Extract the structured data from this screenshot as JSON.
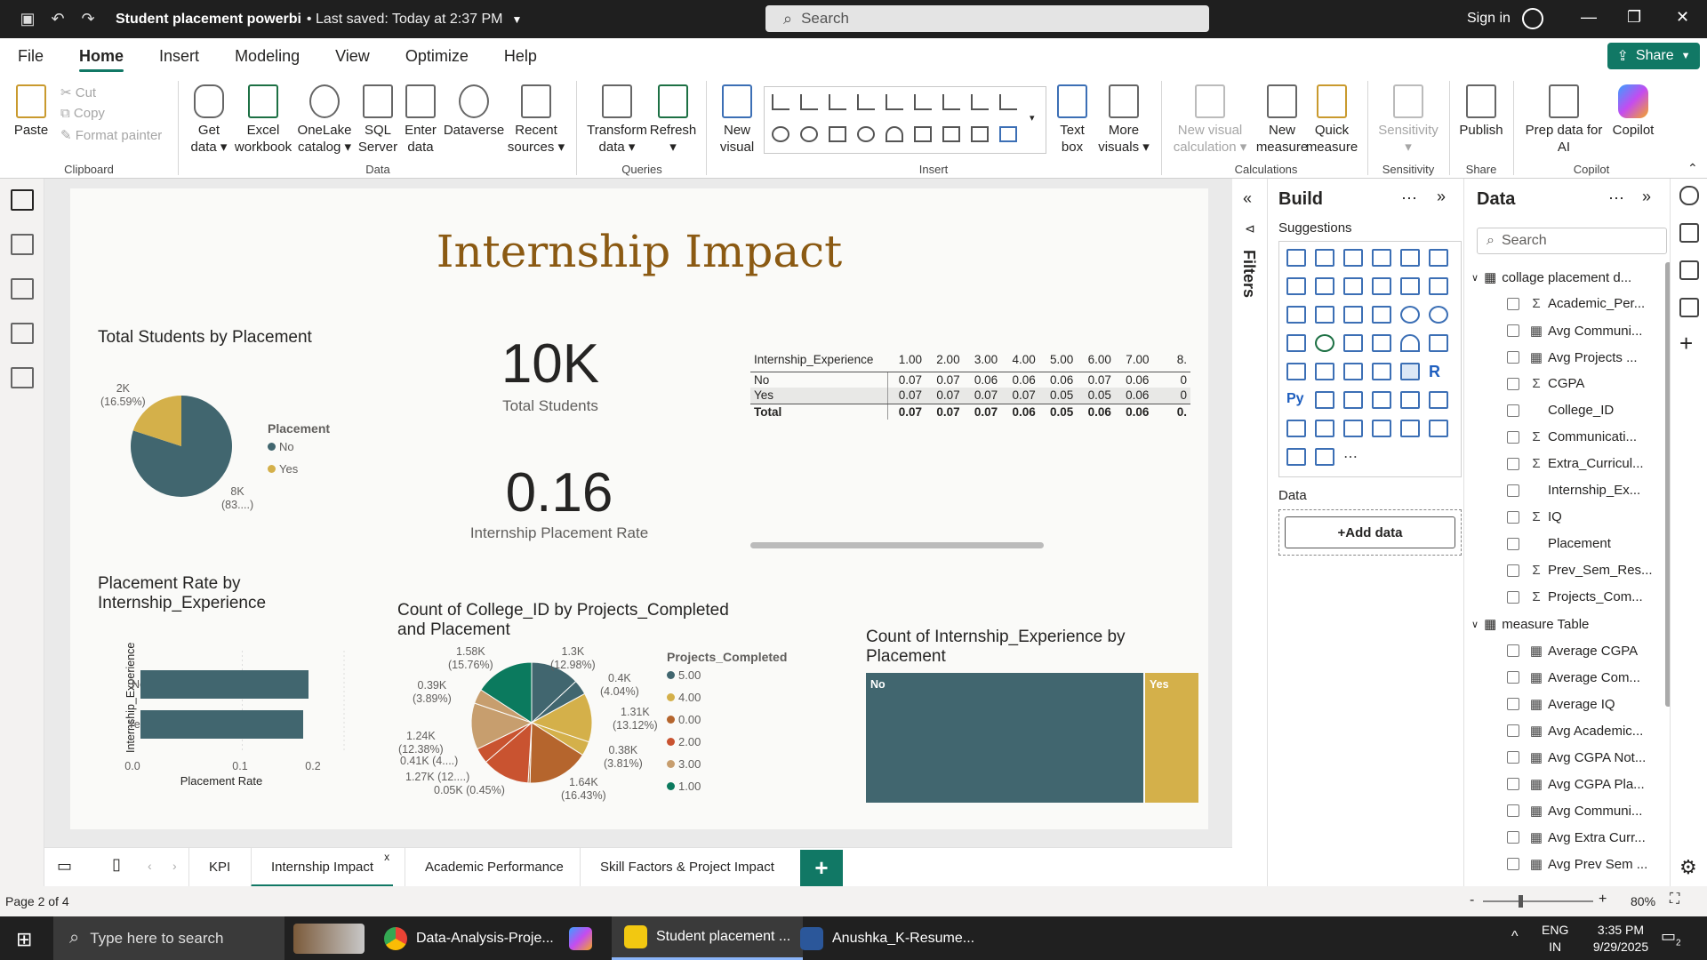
{
  "titlebar": {
    "doc_title": "Student placement powerbi",
    "saved": "• Last saved: Today at 2:37 PM",
    "search": "Search",
    "signin": "Sign in"
  },
  "menu": [
    "File",
    "Home",
    "Insert",
    "Modeling",
    "View",
    "Optimize",
    "Help"
  ],
  "share": "Share",
  "ribbon": {
    "paste": "Paste",
    "cut": "Cut",
    "copy": "Copy",
    "format_painter": "Format painter",
    "clipboard": "Clipboard",
    "get_data": [
      "Get",
      "data"
    ],
    "excel": [
      "Excel",
      "workbook"
    ],
    "onelake": [
      "OneLake",
      "catalog"
    ],
    "sql": [
      "SQL",
      "Server"
    ],
    "enter": [
      "Enter",
      "data"
    ],
    "dataverse": "Dataverse",
    "recent": [
      "Recent",
      "sources"
    ],
    "data_group": "Data",
    "transform": [
      "Transform",
      "data"
    ],
    "refresh": "Refresh",
    "queries": "Queries",
    "new_visual": [
      "New",
      "visual"
    ],
    "text_box": [
      "Text",
      "box"
    ],
    "more_visuals": [
      "More",
      "visuals"
    ],
    "insert": "Insert",
    "new_visual_calc": [
      "New visual",
      "calculation"
    ],
    "new_measure": [
      "New",
      "measure"
    ],
    "quick_measure": [
      "Quick",
      "measure"
    ],
    "calculations": "Calculations",
    "sensitivity": "Sensitivity",
    "sensitivity_group": "Sensitivity",
    "publish": "Publish",
    "share_group": "Share",
    "prep_ai": [
      "Prep data for",
      "AI"
    ],
    "copilot": "Copilot",
    "copilot_group": "Copilot"
  },
  "report": {
    "title": "Internship Impact",
    "pie1": {
      "title": "Total Students by Placement",
      "legend_title": "Placement",
      "legend": [
        "No",
        "Yes"
      ],
      "label_yes": [
        "2K",
        "(16.59%)"
      ],
      "label_no": [
        "8K",
        "(83....)"
      ]
    },
    "kpi1": {
      "value": "10K",
      "label": "Total Students"
    },
    "kpi2": {
      "value": "0.16",
      "label": "Internship Placement Rate"
    },
    "matrix": {
      "header": [
        "Internship_Experience",
        "1.00",
        "2.00",
        "3.00",
        "4.00",
        "5.00",
        "6.00",
        "7.00",
        "8."
      ],
      "rows": [
        [
          "No",
          "0.07",
          "0.07",
          "0.06",
          "0.06",
          "0.06",
          "0.07",
          "0.06",
          "0"
        ],
        [
          "Yes",
          "0.07",
          "0.07",
          "0.07",
          "0.07",
          "0.05",
          "0.05",
          "0.06",
          "0"
        ],
        [
          "Total",
          "0.07",
          "0.07",
          "0.07",
          "0.06",
          "0.05",
          "0.06",
          "0.06",
          "0."
        ]
      ]
    },
    "bar": {
      "title": [
        "Placement Rate by",
        "Internship_Experience"
      ],
      "ylabel": "Internship_Experience",
      "xlabel": "Placement Rate",
      "ticks": [
        "0.0",
        "0.1",
        "0.2"
      ]
    },
    "pie2": {
      "title": [
        "Count of College_ID by Projects_Completed",
        "and Placement"
      ],
      "legend_title": "Projects_Completed",
      "legend": [
        "5.00",
        "4.00",
        "0.00",
        "2.00",
        "3.00",
        "1.00"
      ],
      "labels": [
        [
          "1.3K",
          "(12.98%)"
        ],
        [
          "0.4K",
          "(4.04%)"
        ],
        [
          "1.31K",
          "(13.12%)"
        ],
        [
          "0.38K",
          "(3.81%)"
        ],
        [
          "1.64K",
          "(16.43%)"
        ],
        [
          "0.05K (0.45%)"
        ],
        [
          "1.27K (12....)"
        ],
        [
          "0.41K (4....)"
        ],
        [
          "1.24K",
          "(12.38%)"
        ],
        [
          "0.39K",
          "(3.89%)"
        ],
        [
          "1.58K",
          "(15.76%)"
        ]
      ]
    },
    "treemap": {
      "title": [
        "Count of Internship_Experience by",
        "Placement"
      ],
      "labels": [
        "No",
        "Yes"
      ]
    }
  },
  "chart_data": [
    {
      "type": "pie",
      "title": "Total Students by Placement",
      "categories": [
        "No",
        "Yes"
      ],
      "values": [
        8000,
        2000
      ],
      "percent": [
        83.41,
        16.59
      ]
    },
    {
      "type": "bar",
      "title": "Placement Rate by Internship_Experience",
      "categories": [
        "No",
        "Yes"
      ],
      "values": [
        0.165,
        0.16
      ],
      "xlim": [
        0,
        0.2
      ],
      "xlabel": "Placement Rate",
      "ylabel": "Internship_Experience"
    },
    {
      "type": "pie",
      "title": "Count of College_ID by Projects_Completed and Placement",
      "values": [
        1.3,
        0.4,
        1.31,
        0.38,
        1.64,
        0.05,
        1.27,
        0.41,
        1.24,
        0.39,
        1.58
      ],
      "unit": "K"
    },
    {
      "type": "treemap",
      "title": "Count of Internship_Experience by Placement",
      "categories": [
        "No",
        "Yes"
      ],
      "values": [
        8341,
        1659
      ]
    }
  ],
  "colors": {
    "no": "#41666f",
    "yes": "#d4b04a",
    "p0": "#b5652d",
    "p2": "#c95330",
    "p3": "#c79e6e",
    "p1": "#0b7a5e",
    "accent": "#117865"
  },
  "build": {
    "title": "Build",
    "suggestions": "Suggestions",
    "data": "Data",
    "add_data": "+Add data",
    "filters": "Filters"
  },
  "datapane": {
    "title": "Data",
    "search": "Search",
    "table1": "collage placement d...",
    "fields1": [
      "Academic_Per...",
      "Avg Communi...",
      "Avg Projects ...",
      "CGPA",
      "College_ID",
      "Communicati...",
      "Extra_Curricul...",
      "Internship_Ex...",
      "IQ",
      "Placement",
      "Prev_Sem_Res...",
      "Projects_Com..."
    ],
    "table2": "measure Table",
    "fields2": [
      "Average CGPA",
      "Average Com...",
      "Average IQ",
      "Avg Academic...",
      "Avg CGPA Not...",
      "Avg CGPA Pla...",
      "Avg Communi...",
      "Avg Extra Curr...",
      "Avg Prev Sem ..."
    ]
  },
  "tabs": [
    "KPI",
    "Internship Impact",
    "Academic Performance",
    "Skill Factors & Project Impact"
  ],
  "status": {
    "page": "Page 2 of 4",
    "zoom": "80%"
  },
  "taskbar": {
    "search": "Type here to search",
    "apps": [
      "Data-Analysis-Proje...",
      "Student placement ...",
      "Anushka_K-Resume..."
    ],
    "lang1": "ENG",
    "lang2": "IN",
    "time": "3:35 PM",
    "date": "9/29/2025",
    "notif": "2"
  }
}
